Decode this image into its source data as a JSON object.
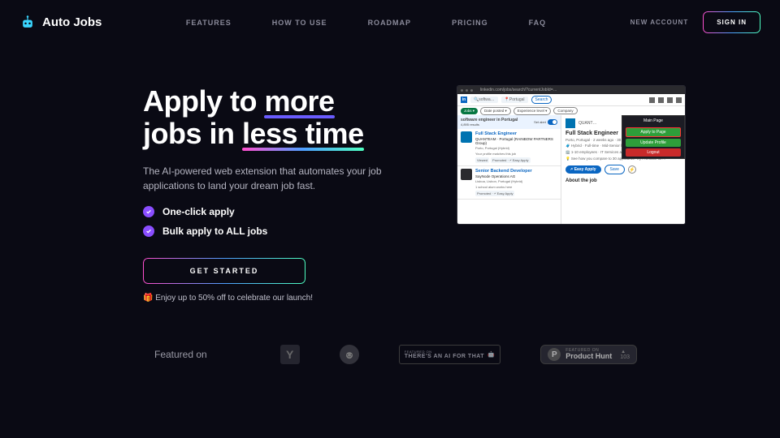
{
  "brand": "Auto Jobs",
  "nav": {
    "features": "FEATURES",
    "how_to_use": "HOW TO USE",
    "roadmap": "ROADMAP",
    "pricing": "PRICING",
    "faq": "FAQ"
  },
  "account": {
    "new_account": "NEW ACCOUNT",
    "sign_in": "SIGN IN"
  },
  "hero": {
    "title_1": "Apply to ",
    "title_more": "more",
    "title_2": "jobs in ",
    "title_less": "less time",
    "subtitle": "The AI-powered web extension that automates your job applications to land your dream job fast.",
    "feature_1": "One-click apply",
    "feature_2": "Bulk apply to ALL jobs",
    "cta": "GET STARTED",
    "promo": "🎁 Enjoy up to 50% off to celebrate our launch!"
  },
  "screenshot": {
    "url": "linkedin.com/jobs/search/?currentJobId=…",
    "search_value": "softwa…",
    "location": "Portugal",
    "search_btn": "Search",
    "filter_jobs": "Jobs ▾",
    "filter_date": "Date posted ▾",
    "filter_exp": "Experience level ▾",
    "filter_company": "Company",
    "banner_title": "software engineer in Portugal",
    "banner_sub": "4,895 results",
    "banner_alert": "Set alert",
    "card1": {
      "title": "Full Stack Engineer",
      "company": "QUANTEAM · Portugal (RAINBOW PARTNERS Group)",
      "loc": "Porto, Portugal (Hybrid)",
      "extra": "Your profile matches this job",
      "tag1": "Viewed",
      "tag2": "Promoted · 🗲 Easy Apply"
    },
    "card2": {
      "title": "Senior Backend Developer",
      "company": "SayNode Operations AG",
      "loc": "Lisboa, Lisbon, Portugal (Hybrid)",
      "extra": "1 school alum works here",
      "tag1": "Promoted · 🗲 Easy Apply"
    },
    "detail": {
      "company": "QUANT…",
      "title": "Full Stack Engineer",
      "meta1": "Porto, Portugal · 2 weeks ago · 30 applicants",
      "meta2": "🧳 Hybrid · Full-time · Mid-Senior level",
      "meta3": "🏢 1-10 employees · IT Services and IT Consulting",
      "meta4": "💡 See how you compare to 30 applicants. Try Premium for…",
      "easy_apply": "🗲 Easy Apply",
      "save": "Save",
      "about": "About the job"
    },
    "ext": {
      "header": "Main Page",
      "apply": "Apply to Page",
      "update": "Update Profile",
      "logout": "Logout"
    }
  },
  "featured": {
    "label": "Featured on",
    "taaft_top": "FEATURED ON",
    "taaft_main": "THERE'S AN AI FOR THAT",
    "ph_top": "FEATURED ON",
    "ph_main": "Product Hunt",
    "ph_count": "103"
  }
}
